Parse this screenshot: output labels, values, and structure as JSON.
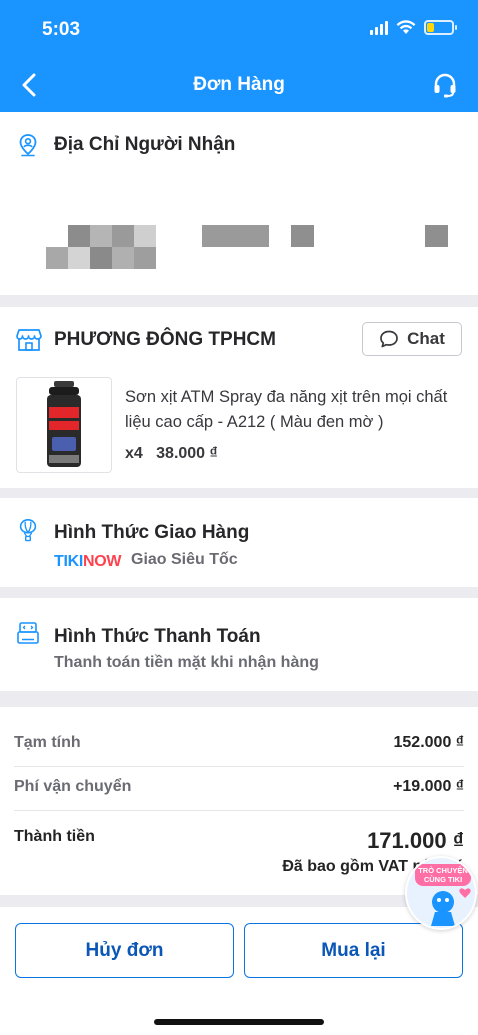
{
  "status_bar": {
    "time": "5:03"
  },
  "header": {
    "title": "Đơn Hàng"
  },
  "address": {
    "title": "Địa Chỉ Người Nhận"
  },
  "shop": {
    "name": "PHƯƠNG ĐÔNG TPHCM",
    "chat_label": "Chat",
    "product": {
      "name": "Sơn xịt ATM Spray đa năng xịt trên mọi chất liệu cao cấp - A212 ( Màu đen mờ )",
      "quantity": "x4",
      "price": "38.000 ₫",
      "image_text": "ATM SPRAY"
    }
  },
  "shipping": {
    "title": "Hình Thức Giao Hàng",
    "brand": "TIKINOW",
    "method": "Giao Siêu Tốc"
  },
  "payment": {
    "title": "Hình Thức Thanh Toán",
    "method": "Thanh toán tiền mặt khi nhận hàng"
  },
  "summary": {
    "subtotal_label": "Tạm tính",
    "subtotal_value": "152.000 ₫",
    "shipping_label": "Phí vận chuyển",
    "shipping_value": "+19.000 ₫",
    "total_label": "Thành tiền",
    "total_value": "171.000 ₫",
    "vat_note": "Đã bao gồm VAT nếu có"
  },
  "actions": {
    "cancel_label": "Hủy đơn",
    "rebuy_label": "Mua lại"
  },
  "chat_bubble": {
    "label": "TRÒ CHUYỆN CÙNG TIKI"
  },
  "colors": {
    "brand_blue": "#1a94ff",
    "button_border": "#0b74e5",
    "button_text": "#0b57b7",
    "battery": "#ffd60a"
  }
}
